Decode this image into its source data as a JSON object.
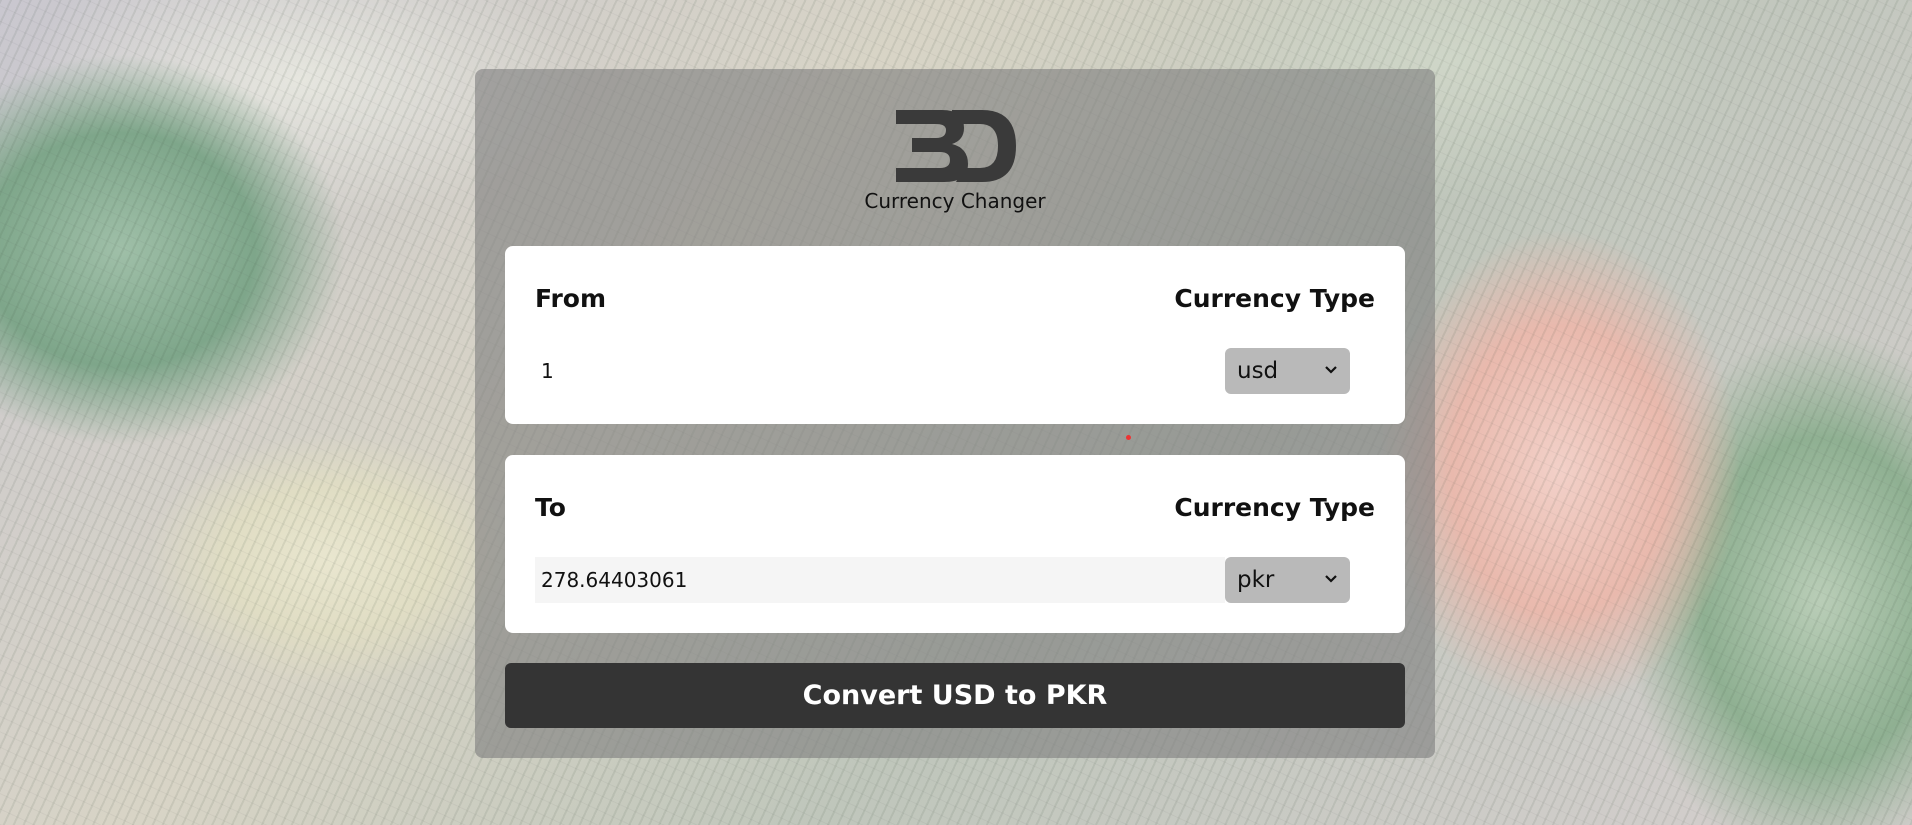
{
  "app": {
    "logo_alt": "BD",
    "title": "Currency Changer"
  },
  "from": {
    "label": "From",
    "type_label": "Currency Type",
    "amount": "1",
    "currency": "usd"
  },
  "to": {
    "label": "To",
    "type_label": "Currency Type",
    "amount": "278.64403061",
    "currency": "pkr"
  },
  "convert_button": {
    "label": "Convert USD to PKR"
  },
  "colors": {
    "button_bg": "#343434",
    "select_bg": "#b9b9b9",
    "panel_bg": "#808080"
  }
}
